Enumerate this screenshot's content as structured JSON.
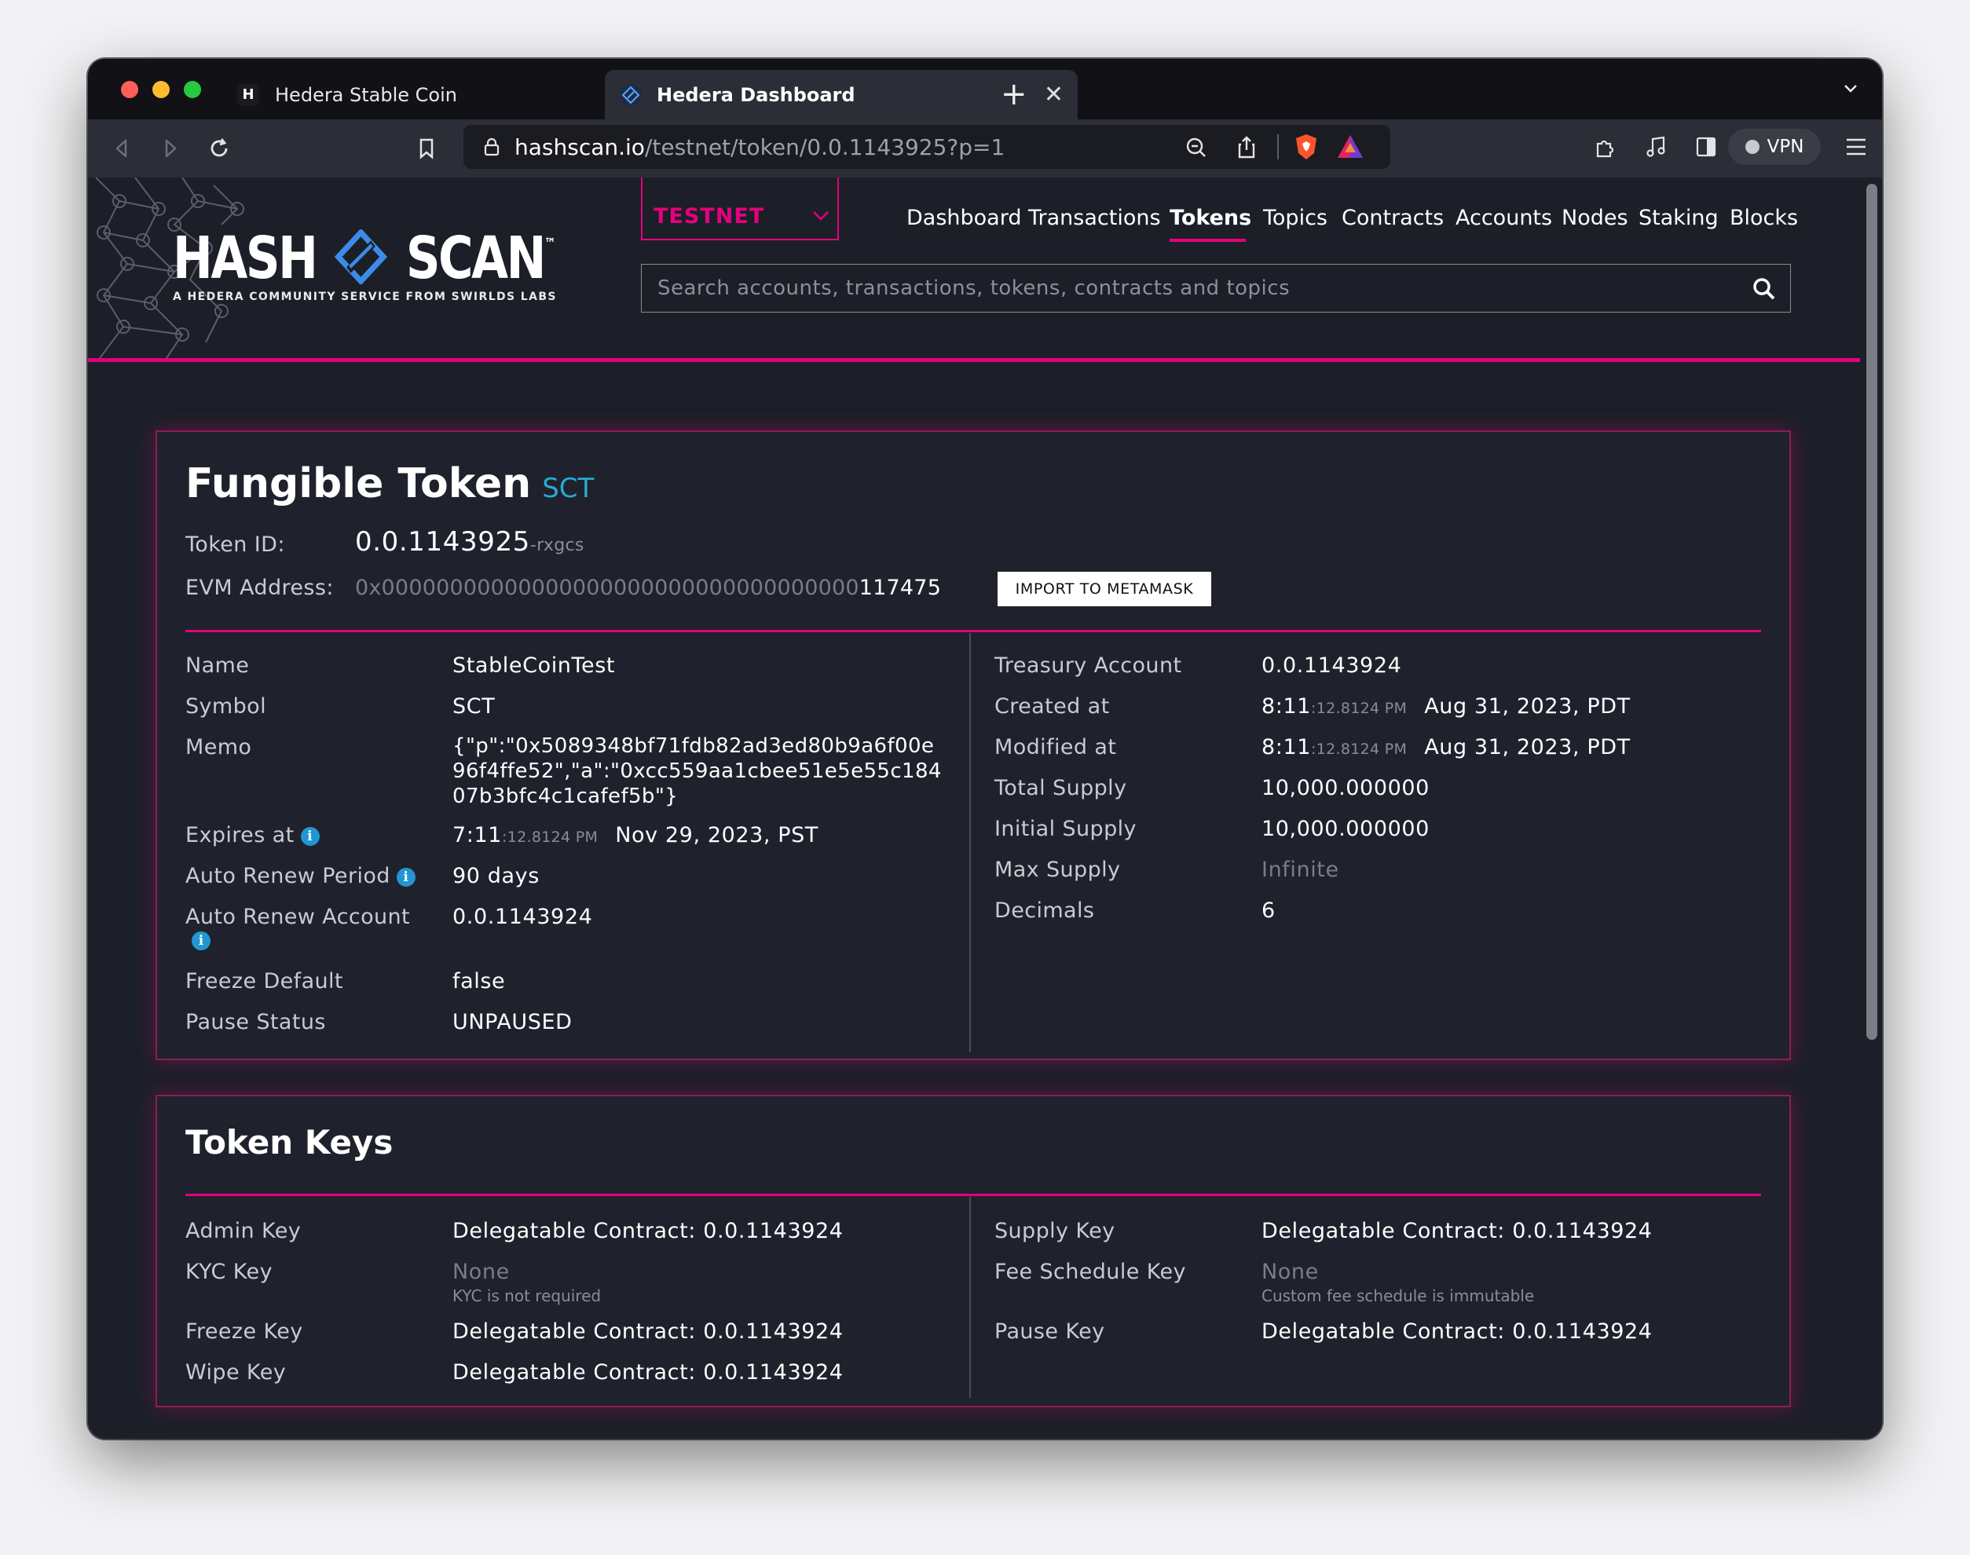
{
  "browser": {
    "tabs": [
      {
        "favicon": "H",
        "title": "Hedera Stable Coin",
        "active": false
      },
      {
        "favicon": "hedera-diamond",
        "title": "Hedera Dashboard",
        "active": true
      }
    ],
    "close_tab_glyph": "✕",
    "new_tab_glyph": "+",
    "url_host": "hashscan.io",
    "url_path": "/testnet/token/0.0.1143925?p=1",
    "vpn_label": "VPN",
    "icons": [
      "back-icon",
      "forward-icon",
      "reload-icon",
      "bookmark-icon",
      "lock-icon",
      "zoom-icon",
      "share-icon",
      "brave-shield-icon",
      "brave-rewards-icon",
      "extensions-icon",
      "media-icon",
      "sidebar-icon",
      "wallet-icon",
      "menu-icon"
    ]
  },
  "header": {
    "logo_text_left": "HASH",
    "logo_text_right": "SCAN",
    "logo_tm": "™",
    "logo_subtitle": "A HEDERA COMMUNITY SERVICE FROM SWIRLDS LABS",
    "network": "TESTNET",
    "nav": [
      "Dashboard",
      "Transactions",
      "Tokens",
      "Topics",
      "Contracts",
      "Accounts",
      "Nodes",
      "Staking",
      "Blocks"
    ],
    "active_nav": "Tokens",
    "search_placeholder": "Search accounts, transactions, tokens, contracts and topics"
  },
  "token": {
    "title": "Fungible Token",
    "symbol_badge": "SCT",
    "token_id_label": "Token ID:",
    "token_id": "0.0.1143925",
    "token_id_checksum": "-rxgcs",
    "evm_label": "EVM Address:",
    "evm_prefix": "0x00000000000000000000000000000000000",
    "evm_suffix": "117475",
    "import_button": "IMPORT TO METAMASK",
    "left": {
      "name_label": "Name",
      "name": "StableCoinTest",
      "symbol_label": "Symbol",
      "symbol": "SCT",
      "memo_label": "Memo",
      "memo": "{\"p\":\"0x5089348bf71fdb82ad3ed80b9a6f00e96f4ffe52\",\"a\":\"0xcc559aa1cbee51e5e55c18407b3bfc4c1cafef5b\"}",
      "expires_label": "Expires at",
      "expires_time": "7:11",
      "expires_seconds": ":12.8124 PM",
      "expires_date": "Nov 29, 2023, PST",
      "renew_period_label": "Auto Renew Period",
      "renew_period": "90 days",
      "renew_account_label": "Auto Renew Account",
      "renew_account": "0.0.1143924",
      "freeze_default_label": "Freeze Default",
      "freeze_default": "false",
      "pause_status_label": "Pause Status",
      "pause_status": "UNPAUSED"
    },
    "right": {
      "treasury_label": "Treasury Account",
      "treasury": "0.0.1143924",
      "created_label": "Created at",
      "created_time": "8:11",
      "created_seconds": ":12.8124 PM",
      "created_date": "Aug 31, 2023, PDT",
      "modified_label": "Modified at",
      "modified_time": "8:11",
      "modified_seconds": ":12.8124 PM",
      "modified_date": "Aug 31, 2023, PDT",
      "total_supply_label": "Total Supply",
      "total_supply": "10,000.000000",
      "initial_supply_label": "Initial Supply",
      "initial_supply": "10,000.000000",
      "max_supply_label": "Max Supply",
      "max_supply": "Infinite",
      "decimals_label": "Decimals",
      "decimals": "6"
    }
  },
  "keys": {
    "title": "Token Keys",
    "admin_label": "Admin Key",
    "admin": "Delegatable Contract: 0.0.1143924",
    "kyc_label": "KYC Key",
    "kyc": "None",
    "kyc_note": "KYC is not required",
    "freeze_label": "Freeze Key",
    "freeze": "Delegatable Contract: 0.0.1143924",
    "wipe_label": "Wipe Key",
    "wipe": "Delegatable Contract: 0.0.1143924",
    "supply_label": "Supply Key",
    "supply": "Delegatable Contract: 0.0.1143924",
    "fee_label": "Fee Schedule Key",
    "fee": "None",
    "fee_note": "Custom fee schedule is immutable",
    "pause_label": "Pause Key",
    "pause": "Delegatable Contract: 0.0.1143924"
  },
  "colors": {
    "accent": "#e6007e",
    "symbol": "#2aa9d6",
    "info": "#2196d3",
    "background": "#1c1f28"
  }
}
